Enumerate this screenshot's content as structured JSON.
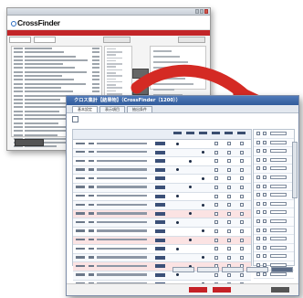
{
  "back_window": {
    "title": "",
    "logo_text": "CrossFinder",
    "brand_right": "",
    "header_bar": "",
    "bottom_button": ""
  },
  "front_window": {
    "title": "クロス集計【結果物】（CrossFinder（1200））",
    "tabs": [
      "基本設定",
      "表示項目",
      "抽出条件"
    ],
    "active_tab": 0,
    "info_text": "",
    "note_text": "",
    "footer_text": "",
    "column_headers": [
      "",
      "",
      "",
      "",
      ""
    ],
    "rows": 17,
    "highlight_rows": [
      8,
      11,
      14
    ]
  },
  "colors": {
    "accent_red": "#c52126",
    "title_blue": "#3a64a4",
    "arrow_red": "#d42a24"
  }
}
